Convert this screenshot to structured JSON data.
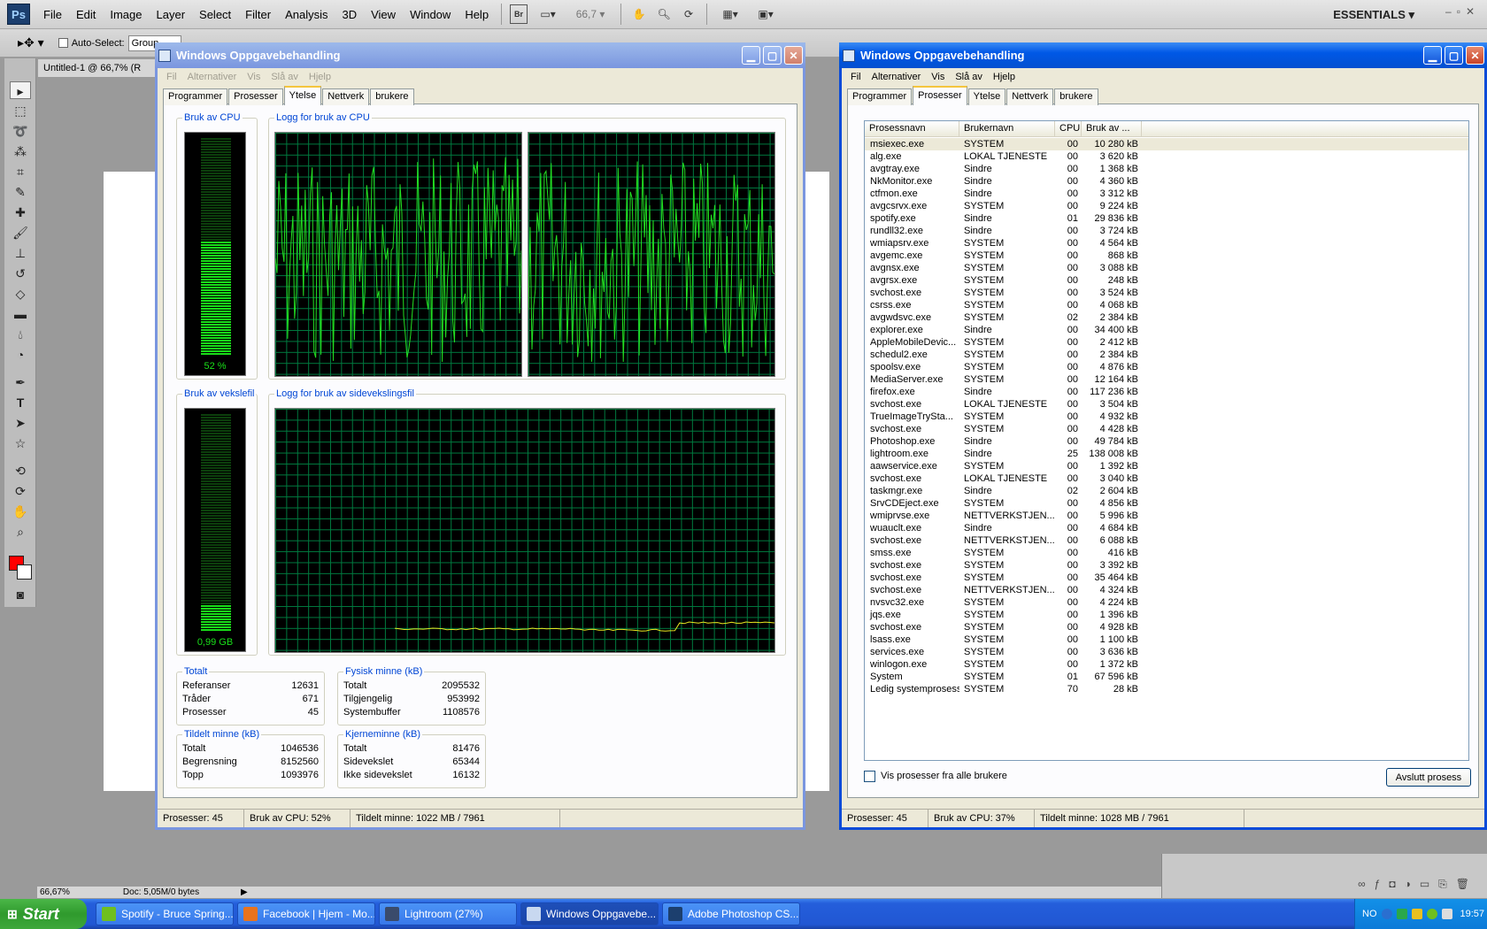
{
  "photoshop": {
    "logo": "Ps",
    "menu": [
      "File",
      "Edit",
      "Image",
      "Layer",
      "Select",
      "Filter",
      "Analysis",
      "3D",
      "View",
      "Window",
      "Help"
    ],
    "zoom_field": "66,7",
    "workspace": "ESSENTIALS",
    "auto_select_label": "Auto-Select:",
    "auto_select_value": "Group",
    "doc_tab": "Untitled-1 @ 66,7% (R",
    "status_zoom": "66,67%",
    "status_doc": "Doc: 5,05M/0 bytes",
    "bridge_label": "Br"
  },
  "perf_window": {
    "title": "Windows Oppgavebehandling",
    "menu": [
      "Fil",
      "Alternativer",
      "Vis",
      "Slå av",
      "Hjelp"
    ],
    "tabs": [
      "Programmer",
      "Prosesser",
      "Ytelse",
      "Nettverk",
      "brukere"
    ],
    "active_tab": "Ytelse",
    "cpu_usage_label": "Bruk av CPU",
    "cpu_usage_value": "52 %",
    "cpu_usage_fraction": 0.52,
    "cpu_history_label": "Logg for bruk av CPU",
    "page_usage_label": "Bruk av vekslefil",
    "page_usage_value": "0,99 GB",
    "page_usage_fraction": 0.12,
    "page_history_label": "Logg for bruk av sidevekslingsfil",
    "totals": {
      "label": "Totalt",
      "rows": [
        [
          "Referanser",
          "12631"
        ],
        [
          "Tråder",
          "671"
        ],
        [
          "Prosesser",
          "45"
        ]
      ]
    },
    "physical": {
      "label": "Fysisk minne (kB)",
      "rows": [
        [
          "Totalt",
          "2095532"
        ],
        [
          "Tilgjengelig",
          "953992"
        ],
        [
          "Systembuffer",
          "1108576"
        ]
      ]
    },
    "commit": {
      "label": "Tildelt minne (kB)",
      "rows": [
        [
          "Totalt",
          "1046536"
        ],
        [
          "Begrensning",
          "8152560"
        ],
        [
          "Topp",
          "1093976"
        ]
      ]
    },
    "kernel": {
      "label": "Kjerneminne (kB)",
      "rows": [
        [
          "Totalt",
          "81476"
        ],
        [
          "Sidevekslet",
          "65344"
        ],
        [
          "Ikke sidevekslet",
          "16132"
        ]
      ]
    },
    "status": [
      "Prosesser: 45",
      "Bruk av CPU: 52%",
      "Tildelt minne: 1022 MB / 7961"
    ]
  },
  "proc_window": {
    "title": "Windows Oppgavebehandling",
    "menu": [
      "Fil",
      "Alternativer",
      "Vis",
      "Slå av",
      "Hjelp"
    ],
    "tabs": [
      "Programmer",
      "Prosesser",
      "Ytelse",
      "Nettverk",
      "brukere"
    ],
    "active_tab": "Prosesser",
    "columns": [
      "Prosessnavn",
      "Brukernavn",
      "CPU",
      "Bruk av ..."
    ],
    "processes": [
      [
        "msiexec.exe",
        "SYSTEM",
        "00",
        "10 280 kB"
      ],
      [
        "alg.exe",
        "LOKAL TJENESTE",
        "00",
        "3 620 kB"
      ],
      [
        "avgtray.exe",
        "Sindre",
        "00",
        "1 368 kB"
      ],
      [
        "NkMonitor.exe",
        "Sindre",
        "00",
        "4 360 kB"
      ],
      [
        "ctfmon.exe",
        "Sindre",
        "00",
        "3 312 kB"
      ],
      [
        "avgcsrvx.exe",
        "SYSTEM",
        "00",
        "9 224 kB"
      ],
      [
        "spotify.exe",
        "Sindre",
        "01",
        "29 836 kB"
      ],
      [
        "rundll32.exe",
        "Sindre",
        "00",
        "3 724 kB"
      ],
      [
        "wmiapsrv.exe",
        "SYSTEM",
        "00",
        "4 564 kB"
      ],
      [
        "avgemc.exe",
        "SYSTEM",
        "00",
        "868 kB"
      ],
      [
        "avgnsx.exe",
        "SYSTEM",
        "00",
        "3 088 kB"
      ],
      [
        "avgrsx.exe",
        "SYSTEM",
        "00",
        "248 kB"
      ],
      [
        "svchost.exe",
        "SYSTEM",
        "00",
        "3 524 kB"
      ],
      [
        "csrss.exe",
        "SYSTEM",
        "00",
        "4 068 kB"
      ],
      [
        "avgwdsvc.exe",
        "SYSTEM",
        "02",
        "2 384 kB"
      ],
      [
        "explorer.exe",
        "Sindre",
        "00",
        "34 400 kB"
      ],
      [
        "AppleMobileDevic...",
        "SYSTEM",
        "00",
        "2 412 kB"
      ],
      [
        "schedul2.exe",
        "SYSTEM",
        "00",
        "2 384 kB"
      ],
      [
        "spoolsv.exe",
        "SYSTEM",
        "00",
        "4 876 kB"
      ],
      [
        "MediaServer.exe",
        "SYSTEM",
        "00",
        "12 164 kB"
      ],
      [
        "firefox.exe",
        "Sindre",
        "00",
        "117 236 kB"
      ],
      [
        "svchost.exe",
        "LOKAL TJENESTE",
        "00",
        "3 504 kB"
      ],
      [
        "TrueImageTrySta...",
        "SYSTEM",
        "00",
        "4 932 kB"
      ],
      [
        "svchost.exe",
        "SYSTEM",
        "00",
        "4 428 kB"
      ],
      [
        "Photoshop.exe",
        "Sindre",
        "00",
        "49 784 kB"
      ],
      [
        "lightroom.exe",
        "Sindre",
        "25",
        "138 008 kB"
      ],
      [
        "aawservice.exe",
        "SYSTEM",
        "00",
        "1 392 kB"
      ],
      [
        "svchost.exe",
        "LOKAL TJENESTE",
        "00",
        "3 040 kB"
      ],
      [
        "taskmgr.exe",
        "Sindre",
        "02",
        "2 604 kB"
      ],
      [
        "SrvCDEject.exe",
        "SYSTEM",
        "00",
        "4 856 kB"
      ],
      [
        "wmiprvse.exe",
        "NETTVERKSTJEN...",
        "00",
        "5 996 kB"
      ],
      [
        "wuauclt.exe",
        "Sindre",
        "00",
        "4 684 kB"
      ],
      [
        "svchost.exe",
        "NETTVERKSTJEN...",
        "00",
        "6 088 kB"
      ],
      [
        "smss.exe",
        "SYSTEM",
        "00",
        "416 kB"
      ],
      [
        "svchost.exe",
        "SYSTEM",
        "00",
        "3 392 kB"
      ],
      [
        "svchost.exe",
        "SYSTEM",
        "00",
        "35 464 kB"
      ],
      [
        "svchost.exe",
        "NETTVERKSTJEN...",
        "00",
        "4 324 kB"
      ],
      [
        "nvsvc32.exe",
        "SYSTEM",
        "00",
        "4 224 kB"
      ],
      [
        "jqs.exe",
        "SYSTEM",
        "00",
        "1 396 kB"
      ],
      [
        "svchost.exe",
        "SYSTEM",
        "00",
        "4 928 kB"
      ],
      [
        "lsass.exe",
        "SYSTEM",
        "00",
        "1 100 kB"
      ],
      [
        "services.exe",
        "SYSTEM",
        "00",
        "3 636 kB"
      ],
      [
        "winlogon.exe",
        "SYSTEM",
        "00",
        "1 372 kB"
      ],
      [
        "System",
        "SYSTEM",
        "01",
        "67 596 kB"
      ],
      [
        "Ledig systemprosess",
        "SYSTEM",
        "70",
        "28 kB"
      ]
    ],
    "show_all_label": "Vis prosesser fra alle brukere",
    "end_process_label": "Avslutt prosess",
    "status": [
      "Prosesser: 45",
      "Bruk av CPU: 37%",
      "Tildelt minne: 1028 MB / 7961"
    ]
  },
  "taskbar": {
    "start_label": "Start",
    "buttons": [
      {
        "label": "Spotify - Bruce Spring...",
        "color": "#6fbf1f"
      },
      {
        "label": "Facebook | Hjem - Mo...",
        "color": "#e8731e"
      },
      {
        "label": "Lightroom (27%)",
        "color": "#3a4b6b"
      },
      {
        "label": "Windows Oppgavebe...",
        "color": "#c8d8f0"
      },
      {
        "label": "Adobe Photoshop CS...",
        "color": "#1c3f6e"
      }
    ],
    "lang": "NO",
    "clock": "19:57"
  }
}
